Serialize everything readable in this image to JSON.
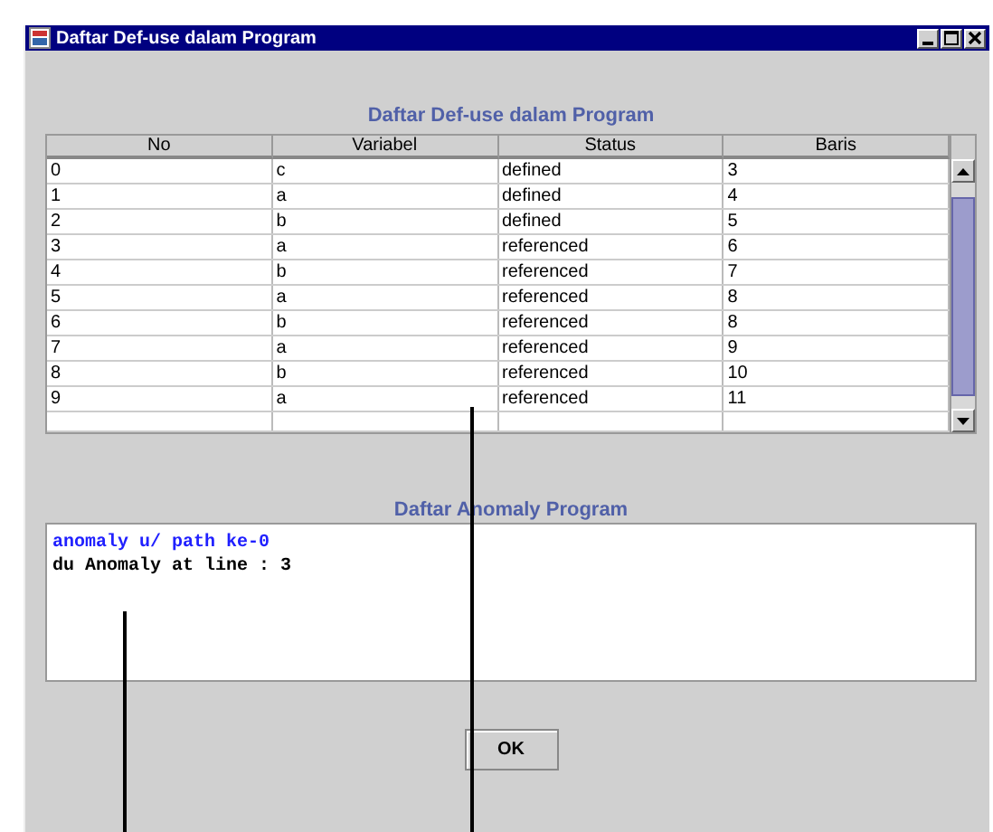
{
  "window": {
    "title": "Daftar Def-use dalam Program"
  },
  "defuse_table": {
    "title": "Daftar Def-use dalam Program",
    "columns": [
      "No",
      "Variabel",
      "Status",
      "Baris"
    ],
    "rows": [
      [
        "0",
        "c",
        "defined",
        "3"
      ],
      [
        "1",
        "a",
        "defined",
        "4"
      ],
      [
        "2",
        "b",
        "defined",
        "5"
      ],
      [
        "3",
        "a",
        "referenced",
        "6"
      ],
      [
        "4",
        "b",
        "referenced",
        "7"
      ],
      [
        "5",
        "a",
        "referenced",
        "8"
      ],
      [
        "6",
        "b",
        "referenced",
        "8"
      ],
      [
        "7",
        "a",
        "referenced",
        "9"
      ],
      [
        "8",
        "b",
        "referenced",
        "10"
      ],
      [
        "9",
        "a",
        "referenced",
        "11"
      ]
    ]
  },
  "anomaly": {
    "title": "Daftar Anomaly Program",
    "lines": [
      {
        "text": "anomaly u/ path ke-0",
        "color": "#2020ff"
      },
      {
        "text": "du Anomaly at line : 3",
        "color": "#000000"
      }
    ]
  },
  "buttons": [
    "OK"
  ]
}
